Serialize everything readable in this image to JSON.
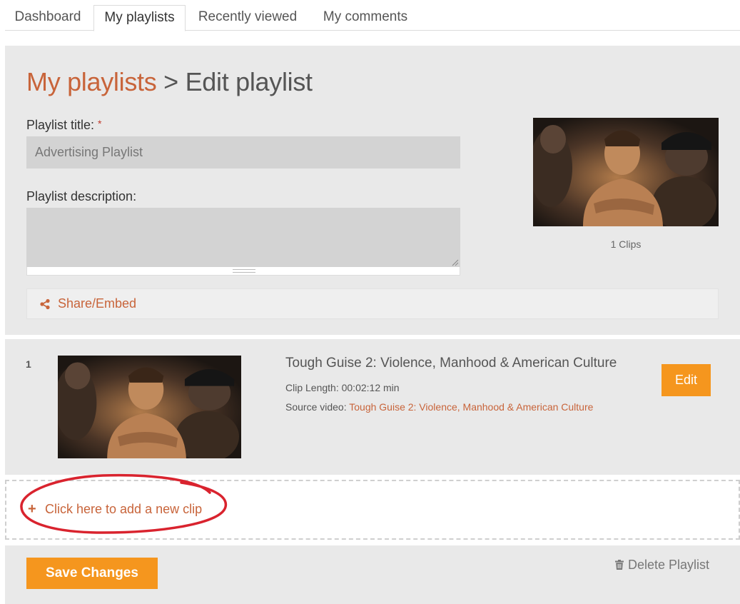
{
  "tabs": [
    {
      "label": "Dashboard"
    },
    {
      "label": "My playlists"
    },
    {
      "label": "Recently viewed"
    },
    {
      "label": "My comments"
    }
  ],
  "page": {
    "breadcrumb_link": "My playlists",
    "breadcrumb_sep": " > ",
    "breadcrumb_current": "Edit playlist"
  },
  "form": {
    "title_label": "Playlist title:",
    "required_mark": "*",
    "title_value": "Advertising Playlist",
    "description_label": "Playlist description:",
    "description_value": ""
  },
  "playlist": {
    "clip_count": "1 Clips"
  },
  "share": {
    "label": "Share/Embed",
    "icon": "share-icon"
  },
  "clips": [
    {
      "index": "1",
      "title": "Tough Guise 2: Violence, Manhood & American Culture",
      "length_label": "Clip Length: 00:02:12 min",
      "source_prefix": "Source video: ",
      "source_link": "Tough Guise 2: Violence, Manhood & American Culture",
      "edit_label": "Edit"
    }
  ],
  "add_clip": {
    "plus": "+",
    "label": "Click here to add a new clip"
  },
  "actions": {
    "save_label": "Save Changes",
    "delete_label": "Delete Playlist"
  },
  "colors": {
    "accent": "#c8643a",
    "button": "#f5961e",
    "panel": "#e9e9e9",
    "annotation": "#d9232e"
  }
}
